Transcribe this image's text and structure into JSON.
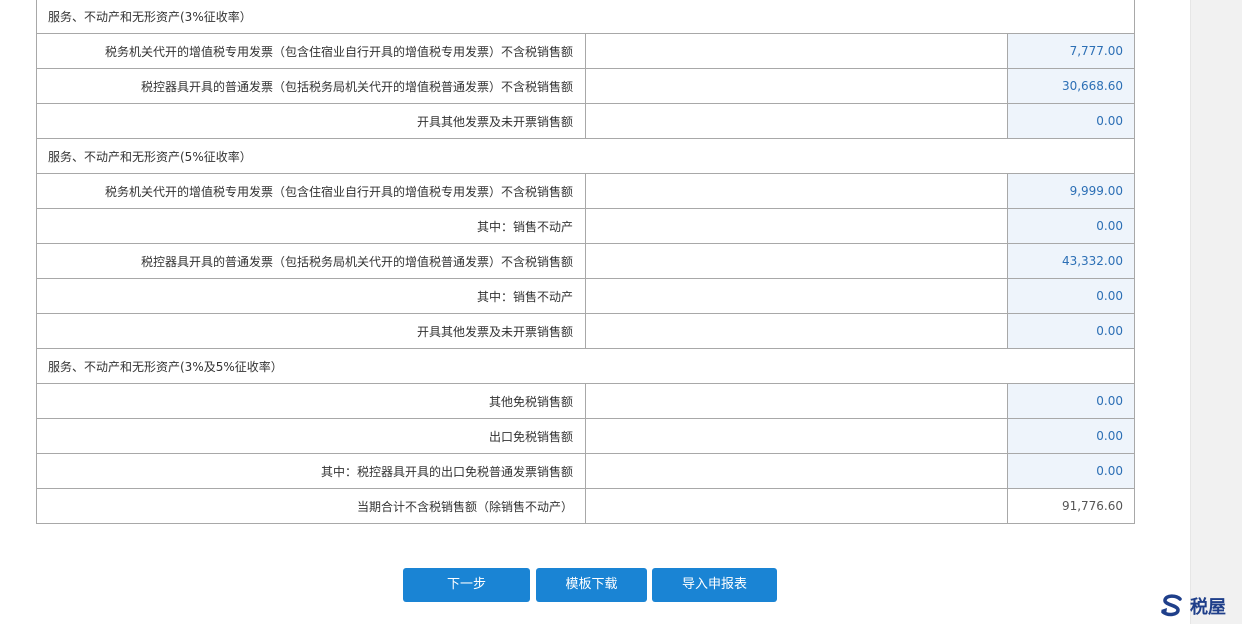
{
  "sections": [
    {
      "header": "服务、不动产和无形资产(3%征收率）",
      "rows": [
        {
          "label": "税务机关代开的增值税专用发票（包含住宿业自行开具的增值税专用发票）不含税销售额",
          "value": "7,777.00"
        },
        {
          "label": "税控器具开具的普通发票（包括税务局机关代开的增值税普通发票）不含税销售额",
          "value": "30,668.60"
        },
        {
          "label": "开具其他发票及未开票销售额",
          "value": "0.00"
        }
      ]
    },
    {
      "header": "服务、不动产和无形资产(5%征收率）",
      "rows": [
        {
          "label": "税务机关代开的增值税专用发票（包含住宿业自行开具的增值税专用发票）不含税销售额",
          "value": "9,999.00"
        },
        {
          "label": "其中：销售不动产",
          "value": "0.00"
        },
        {
          "label": "税控器具开具的普通发票（包括税务局机关代开的增值税普通发票）不含税销售额",
          "value": "43,332.00"
        },
        {
          "label": "其中：销售不动产",
          "value": "0.00"
        },
        {
          "label": "开具其他发票及未开票销售额",
          "value": "0.00"
        }
      ]
    },
    {
      "header": "服务、不动产和无形资产(3%及5%征收率）",
      "rows": [
        {
          "label": "其他免税销售额",
          "value": "0.00"
        },
        {
          "label": "出口免税销售额",
          "value": "0.00"
        },
        {
          "label": "其中：税控器具开具的出口免税普通发票销售额",
          "value": "0.00"
        }
      ]
    }
  ],
  "total": {
    "label": "当期合计不含税销售额（除销售不动产）",
    "value": "91,776.60"
  },
  "buttons": {
    "next": "下一步",
    "template_download": "模板下载",
    "import_report": "导入申报表"
  },
  "logo": {
    "text": "税屋",
    "icon": "s-arrow-logo-icon"
  },
  "colors": {
    "button": "#1a84d4",
    "input_bg": "#eef4fb",
    "input_text": "#2c6fb5"
  }
}
